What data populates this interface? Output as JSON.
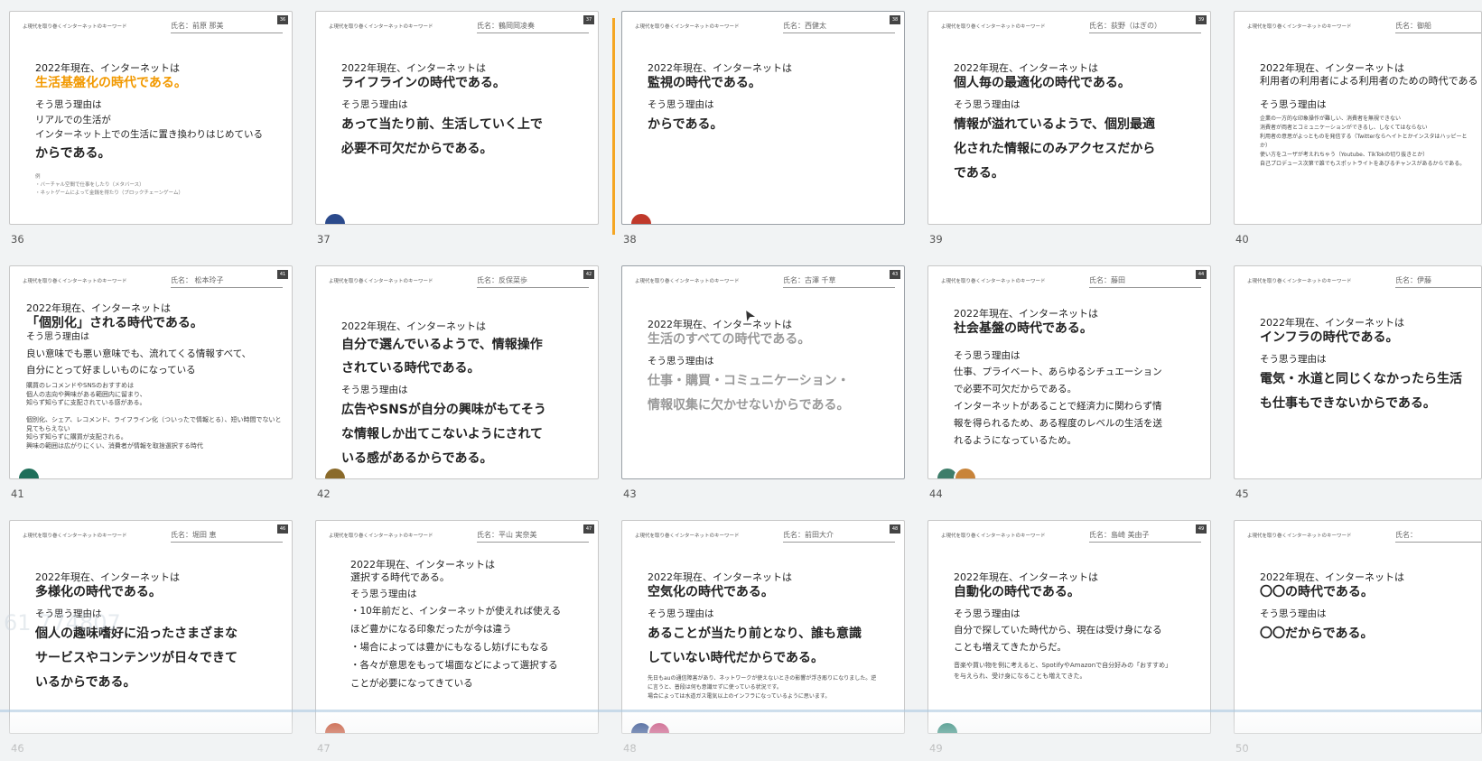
{
  "header_text": "よ現代を取り巻くインターネットのキーワード",
  "ghost_text": "61 774807",
  "slides": [
    {
      "num": "36",
      "name": "氏名：前原 那美",
      "badge": "36",
      "l1": "2022年現在、インターネットは",
      "l2": "生活基盤化の時代である。",
      "l3": "そう思う理由は",
      "reason": "リアルでの生活が\nインターネット上での生活に置き換わりはじめている",
      "reason2": "からである。",
      "bullets": "例\n・バーチャル空間で仕事をしたり（メタバース）\n・ネットゲームによって金銭を得たり（ブロックチェーンゲーム）"
    },
    {
      "num": "37",
      "name": "氏名：鶴岡岡凌奏",
      "badge": "37",
      "l1": "2022年現在、インターネットは",
      "l2": "ライフラインの時代である。",
      "l3": "そう思う理由は",
      "reason": "あって当たり前、生活していく上で必要不可欠だからである。"
    },
    {
      "num": "38",
      "name": "氏名：西健太",
      "badge": "38",
      "l1": "2022年現在、インターネットは",
      "l2": "監視の時代である。",
      "l3": "そう思う理由は",
      "reason": "からである。"
    },
    {
      "num": "39",
      "name": "氏名：荻野（はぎの）",
      "badge": "39",
      "l1": "2022年現在、インターネットは",
      "l2": "個人毎の最適化の時代である。",
      "l3": "そう思う理由は",
      "reason": "情報が溢れているようで、個別最適化された情報にのみアクセスだからである。"
    },
    {
      "num": "40",
      "name": "氏名：御船",
      "badge": "",
      "l1": "2022年現在、インターネットは",
      "l2": "利用者の利用者による利用者のための時代である",
      "l3": "そう思う理由は",
      "reason": "企業の一方的な印象操作が難しい、消費者を無視できない\n消費者が両者とコミュニケーションができるし、しなくてはならない\n利用者の意思がよっとものを発信する（Twitterならヘイトとかインスタはハッピーとか）\n使い方をユーザが考えれちゃう（Youtube、TikTokの切り抜きとか）\n自己プロデュース次第で誰でもスポットライトをあびるチャンスがあるからである。"
    },
    {
      "num": "41",
      "name": "氏名： 松本玲子",
      "badge": "41",
      "l1": "2022年現在、インターネットは",
      "l2": "「個別化」される時代である。",
      "l3": "そう思う理由は",
      "reason": "良い意味でも悪い意味でも、流れてくる情報すべて、\n自分にとって好ましいものになっている",
      "reason2": "購買のレコメンドやSNSのおすすめは\n個人の志向や興味がある範囲内に留まり、\n知らず知らずに支配されている感がある。\n\n個別化、シェア、レコメンド、ライフライン化（ついったで情報とる）、短い時間でないと見てもらえない\n知らず知らずに購買が支配される。\n興味の範囲は広がりにくい、消費者が情報を取捨選択する時代"
    },
    {
      "num": "42",
      "name": "氏名：反保菜歩",
      "badge": "42",
      "l1": "2022年現在、インターネットは",
      "l2": "自分で選んでいるようで、情報操作されている時代である。",
      "l3": "そう思う理由は",
      "reason": "広告やSNSが自分の興味がもてそうな情報しか出てこないようにされている感があるからである。"
    },
    {
      "num": "43",
      "name": "氏名：古澤 千草",
      "badge": "43",
      "l1": "2022年現在、インターネットは",
      "l2": "生活のすべての時代である。",
      "l3": "そう思う理由は",
      "reason": "仕事・購買・コミュニケーション・情報収集に欠かせないからである。"
    },
    {
      "num": "44",
      "name": "氏名：藤田",
      "badge": "44",
      "l1": "2022年現在、インターネットは",
      "l2": "社会基盤の時代である。",
      "l3": "そう思う理由は",
      "reason": "仕事、プライベート、あらゆるシチュエーションで必要不可欠だからである。\nインターネットがあることで経済力に関わらず情報を得られるため、ある程度のレベルの生活を送れるようになっているため。"
    },
    {
      "num": "45",
      "name": "氏名：伊藤",
      "badge": "",
      "l1": "2022年現在、インターネットは",
      "l2": "インフラの時代である。",
      "l3": "そう思う理由は",
      "reason": "電気・水道と同じくなかったら生活も仕事もできないからである。"
    },
    {
      "num": "46",
      "name": "氏名：堀田 恵",
      "badge": "46",
      "l1": "2022年現在、インターネットは",
      "l2": "多様化の時代である。",
      "l3": "そう思う理由は",
      "reason": "個人の趣味嗜好に沿ったさまざまなサービスやコンテンツが日々できているからである。"
    },
    {
      "num": "47",
      "name": "氏名：平山 実奈美",
      "badge": "47",
      "l1": "2022年現在、インターネットは",
      "l2": "選択する時代である。",
      "l3": "そう思う理由は",
      "reason": "・10年前だと、インターネットが使えれば使えるほど豊かになる印象だったが今は違う\n・場合によっては豊かにもなるし妨げにもなる\n・各々が意思をもって場面などによって選択することが必要になってきている"
    },
    {
      "num": "48",
      "name": "氏名：前田大介",
      "badge": "48",
      "l1": "2022年現在、インターネットは",
      "l2": "空気化の時代である。",
      "l3": "そう思う理由は",
      "reason": "あることが当たり前となり、誰も意識していない時代だからである。",
      "reason2": "先日もauの通信障害があり、ネットワークが使えないときの影響が浮き彫りになりました。逆に言うと、普段は何も意識せずに使っている状況です。\n場合によっては水道ガス電気以上のインフラになっているように思います。"
    },
    {
      "num": "49",
      "name": "氏名：島崎 美由子",
      "badge": "49",
      "l1": "2022年現在、インターネットは",
      "l2": "自動化の時代である。",
      "l3": "そう思う理由は",
      "reason": "自分で探していた時代から、現在は受け身になることも増えてきたからだ。",
      "reason2": "音楽や買い物を例に考えると、SpotifyやAmazonで自分好みの「おすすめ」を与えられ、受け身になることも増えてきた。"
    },
    {
      "num": "50",
      "name": "氏名：",
      "badge": "",
      "l1": "2022年現在、インターネットは",
      "l2": "〇〇の時代である。",
      "l3": "そう思う理由は",
      "reason": "〇〇だからである。"
    }
  ]
}
